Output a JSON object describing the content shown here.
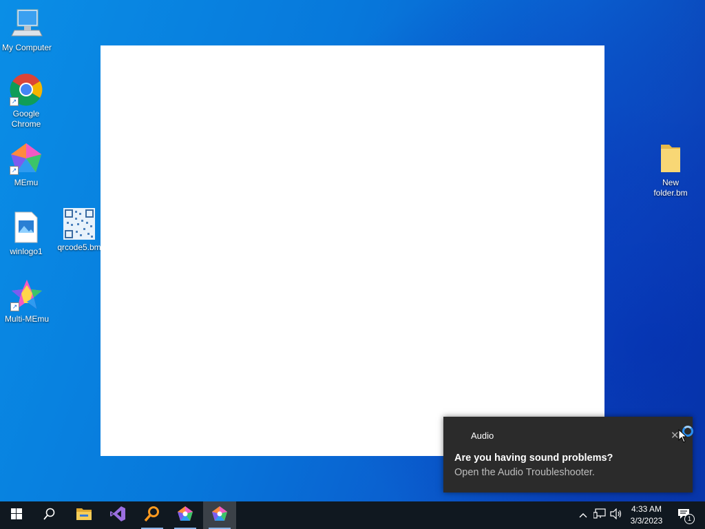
{
  "desktop": {
    "icons": [
      {
        "label": "My Computer",
        "icon": "computer-icon"
      },
      {
        "label": "Google Chrome",
        "icon": "chrome-icon"
      },
      {
        "label": "MEmu",
        "icon": "memu-icon"
      },
      {
        "label": "winlogo1",
        "icon": "image-file-icon"
      },
      {
        "label": "qrcode5.bm",
        "icon": "qrcode-file-icon"
      },
      {
        "label": "Multi-MEmu",
        "icon": "multi-memu-icon"
      },
      {
        "label": "New folder.bm",
        "icon": "folder-icon"
      }
    ]
  },
  "notification": {
    "app": "Audio",
    "headline": "Are you having sound problems?",
    "body": "Open the Audio Troubleshooter.",
    "close_icon": "close-icon"
  },
  "taskbar": {
    "buttons": [
      {
        "icon": "windows-start-icon"
      },
      {
        "icon": "search-icon"
      },
      {
        "icon": "file-explorer-icon"
      },
      {
        "icon": "visual-studio-icon"
      },
      {
        "icon": "search-app-icon"
      },
      {
        "icon": "memu-icon"
      },
      {
        "icon": "memu-active-icon"
      }
    ],
    "clock": {
      "time": "4:33 AM",
      "date": "3/3/2023"
    },
    "notification_count": "1"
  }
}
